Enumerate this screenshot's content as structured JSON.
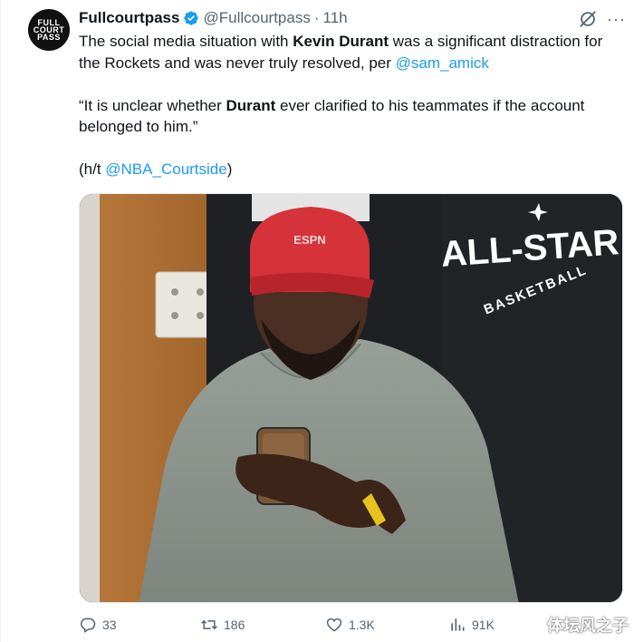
{
  "account": {
    "name": "Fullcourtpass",
    "handle": "@Fullcourtpass",
    "dot": "·",
    "time": "11h",
    "avatar_text": [
      "FULL",
      "COURT",
      "PASS"
    ]
  },
  "tweet": {
    "p1_part1": "The social media situation with ",
    "p1_bold": "Kevin Durant",
    "p1_part2": " was a significant distraction for the Rockets and was never truly resolved, per ",
    "p1_link": "@sam_amick",
    "p2_part1": "“It is unclear whether ",
    "p2_bold": "Durant",
    "p2_part2": " ever clarified to his teammates if the account belonged to him.”",
    "p3_part1": "(h/t ",
    "p3_link": "@NBA_Courtside",
    "p3_part2": ")"
  },
  "media": {
    "shirt_text_big": "ALL-STAR",
    "shirt_text_small": "BASKETBALL",
    "cap_text": "ESPN"
  },
  "actions": {
    "replies": "33",
    "reposts": "186",
    "likes": "1.3K",
    "views": "91K"
  },
  "watermark": {
    "text": "体坛风之子"
  },
  "colors": {
    "accent": "#1d9bf0",
    "secondary_text": "#536471",
    "primary_text": "#0f1419"
  }
}
